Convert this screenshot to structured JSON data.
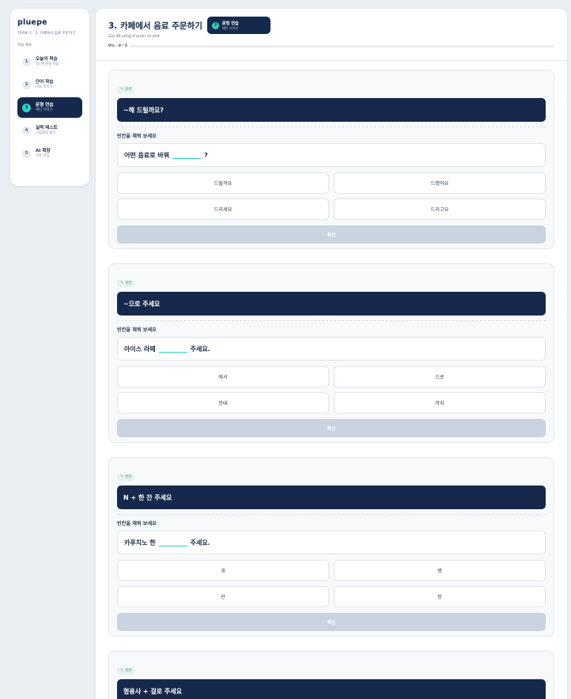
{
  "sidebar": {
    "brand": "pluepe",
    "course_path": "TOPIK 1 · 3. 카페에서 음료 주문하기",
    "menu_label": "학습 메뉴",
    "items": [
      {
        "num": "1",
        "title": "오늘의 학습",
        "sub": "5단계 완성 학습"
      },
      {
        "num": "2",
        "title": "단어 학습",
        "sub": "어휘 익히기"
      },
      {
        "num": "3",
        "title": "문형 연습",
        "sub": "패턴 익히기"
      },
      {
        "num": "4",
        "title": "실력 테스트",
        "sub": "시험처럼 풀기"
      },
      {
        "num": "5",
        "title": "AI 확장",
        "sub": "자유 연습"
      }
    ]
  },
  "header": {
    "title": "3. 카페에서 음료 주문하기",
    "badge": {
      "num": "3",
      "title": "문형 연습",
      "sub": "패턴 익히기"
    },
    "subtitle": "Gọi đồ uống ở quán cà phê",
    "progress_label": "0% · 0 / 5",
    "progress": 0
  },
  "common": {
    "tag_label": "빈칸",
    "instruction": "빈칸을 채워 보세요",
    "confirm_label": "확인"
  },
  "cards": [
    {
      "pattern": "~해 드릴까요?",
      "sentence_before": "어떤 음료로 바꿔",
      "sentence_after": "?",
      "options": [
        "드릴까요",
        "드렸어요",
        "드리세요",
        "드리고요"
      ]
    },
    {
      "pattern": "~으로 주세요",
      "sentence_before": "아이스 라떼",
      "sentence_after": "주세요.",
      "options": [
        "에서",
        "으로",
        "한테",
        "까지"
      ]
    },
    {
      "pattern": "N + 한 잔 주세요",
      "sentence_before": "카푸치노 한",
      "sentence_after": "주세요.",
      "options": [
        "개",
        "병",
        "잔",
        "장"
      ]
    },
    {
      "pattern": "형용사 + 걸로 주세요"
    }
  ],
  "colors": {
    "navy": "#16294d",
    "accent": "#2ed3bf",
    "confirm_disabled": "#c9d4e0"
  }
}
